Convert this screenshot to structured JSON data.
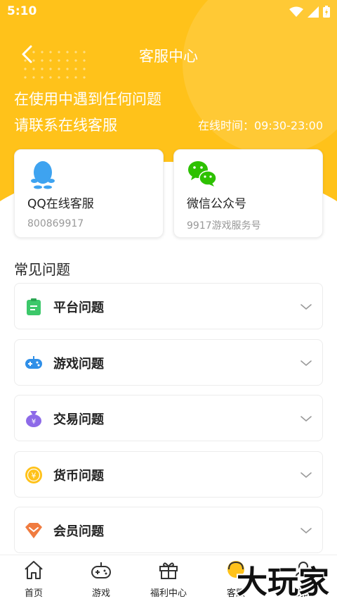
{
  "status": {
    "time": "5:10"
  },
  "header": {
    "title": "客服中心"
  },
  "hero": {
    "line1": "在使用中遇到任何问题",
    "line2": "请联系在线客服",
    "hours_label": "在线时间：",
    "hours_value": "09:30-23:00"
  },
  "contacts": [
    {
      "title": "QQ在线客服",
      "sub": "800869917",
      "icon": "qq-penguin-icon"
    },
    {
      "title": "微信公众号",
      "sub": "9917游戏服务号",
      "icon": "wechat-icon"
    }
  ],
  "faq": {
    "heading": "常见问题",
    "items": [
      {
        "label": "平台问题",
        "icon": "clipboard-icon"
      },
      {
        "label": "游戏问题",
        "icon": "gamepad-icon"
      },
      {
        "label": "交易问题",
        "icon": "money-bag-icon"
      },
      {
        "label": "货币问题",
        "icon": "coin-icon"
      },
      {
        "label": "会员问题",
        "icon": "diamond-icon"
      }
    ]
  },
  "tabs": [
    {
      "label": "首页",
      "icon": "home-icon"
    },
    {
      "label": "游戏",
      "icon": "gamepad-icon"
    },
    {
      "label": "福利中心",
      "icon": "gift-icon"
    },
    {
      "label": "客服",
      "icon": "customer-service-icon"
    },
    {
      "label": "我的",
      "icon": "user-icon"
    }
  ],
  "watermark": "大玩家",
  "colors": {
    "accent": "#ffc21a",
    "qq_blue": "#3ea3f0",
    "wechat_green": "#2dc100"
  }
}
